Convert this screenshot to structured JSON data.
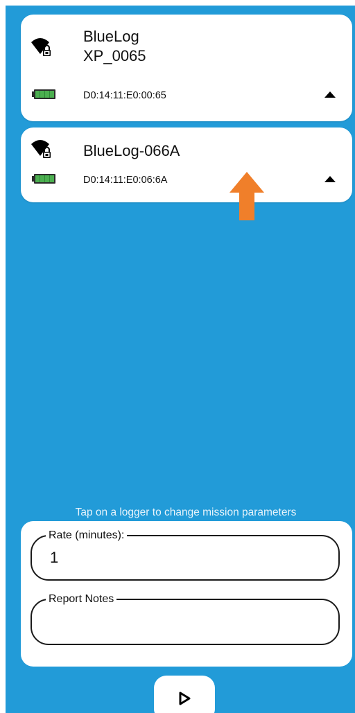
{
  "loggers": [
    {
      "name_line1": "BlueLog",
      "name_line2": "XP_0065",
      "code": "D0:14:11:E0:00:65",
      "signal_icon": "wifi-lock-icon",
      "battery_icon": "battery-full-icon",
      "expand_icon": "caret-up-icon"
    },
    {
      "name_line1": "BlueLog-066A",
      "code": "D0:14:11:E0:06:6A",
      "signal_icon": "wifi-lock-icon",
      "battery_icon": "battery-full-icon",
      "expand_icon": "caret-up-icon"
    }
  ],
  "hint": "Tap on a logger to change mission parameters",
  "form": {
    "rate_label": "Rate (minutes):",
    "rate_value": "1",
    "notes_label": "Report Notes",
    "notes_value": ""
  },
  "play_button": {
    "icon": "play-icon"
  },
  "colors": {
    "background": "#229bd8",
    "card": "#ffffff",
    "battery": "#4caf50",
    "arrow": "#f07f2a"
  }
}
